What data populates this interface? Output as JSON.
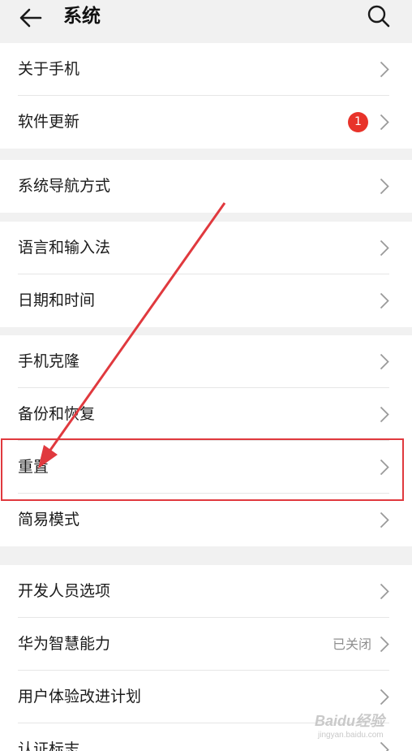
{
  "header": {
    "title": "系统",
    "back_icon": "arrow-left-icon",
    "search_icon": "search-icon"
  },
  "groups": [
    {
      "items": [
        {
          "label": "关于手机"
        },
        {
          "label": "软件更新",
          "badge": "1"
        }
      ]
    },
    {
      "items": [
        {
          "label": "系统导航方式"
        }
      ]
    },
    {
      "items": [
        {
          "label": "语言和输入法"
        },
        {
          "label": "日期和时间"
        }
      ]
    },
    {
      "items": [
        {
          "label": "手机克隆"
        },
        {
          "label": "备份和恢复"
        },
        {
          "label": "重置"
        },
        {
          "label": "简易模式"
        }
      ]
    },
    {
      "items": [
        {
          "label": "开发人员选项"
        },
        {
          "label": "华为智慧能力",
          "status": "已关闭"
        },
        {
          "label": "用户体验改进计划"
        },
        {
          "label": "认证标志"
        }
      ]
    }
  ],
  "annotation": {
    "color": "#e0393e"
  },
  "colors": {
    "badge": "#e8332a",
    "background": "#f1f1f1"
  },
  "watermark": {
    "main": "Baidu经验",
    "sub": "jingyan.baidu.com"
  }
}
